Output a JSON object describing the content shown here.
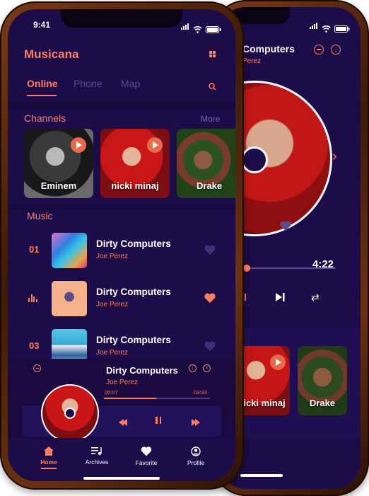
{
  "status": {
    "time": "9:41"
  },
  "app": {
    "brand": "Musicana"
  },
  "tabs": [
    {
      "label": "Online",
      "active": true
    },
    {
      "label": "Phone",
      "active": false
    },
    {
      "label": "Map",
      "active": false
    }
  ],
  "channels": {
    "title": "Channels",
    "more": "More",
    "items": [
      {
        "label": "Eminem"
      },
      {
        "label": "nicki minaj"
      },
      {
        "label": "Drake"
      }
    ]
  },
  "music": {
    "title": "Music",
    "rows": [
      {
        "index": "01",
        "title": "Dirty Computers",
        "artist": "Joe Perez",
        "liked": false,
        "playing": false
      },
      {
        "index": "",
        "title": "Dirty Computers",
        "artist": "Joe Perez",
        "liked": true,
        "playing": true
      },
      {
        "index": "03",
        "title": "Dirty Computers",
        "artist": "Joe Perez",
        "liked": false,
        "playing": false
      }
    ]
  },
  "mini_player": {
    "title": "Dirty Computers",
    "artist": "Joe Perez",
    "elapsed": "00:07",
    "total": "03:33",
    "progress": 0.49
  },
  "bottom_nav": [
    {
      "label": "Home",
      "icon": "home-icon",
      "active": true
    },
    {
      "label": "Archives",
      "icon": "archives-icon",
      "active": false
    },
    {
      "label": "Favorite",
      "icon": "heart-icon",
      "active": false
    },
    {
      "label": "Profile",
      "icon": "profile-icon",
      "active": false
    }
  ],
  "back_player": {
    "title_partial": "Computers",
    "artist_partial": "Perez",
    "time": "4:22",
    "progress": 0.02,
    "channel_labels": [
      "nicki minaj",
      "Drake"
    ]
  },
  "colors": {
    "accent": "#ff7e5f",
    "screen_bg": "#1c0c4a",
    "muted": "#5a4c8f"
  }
}
